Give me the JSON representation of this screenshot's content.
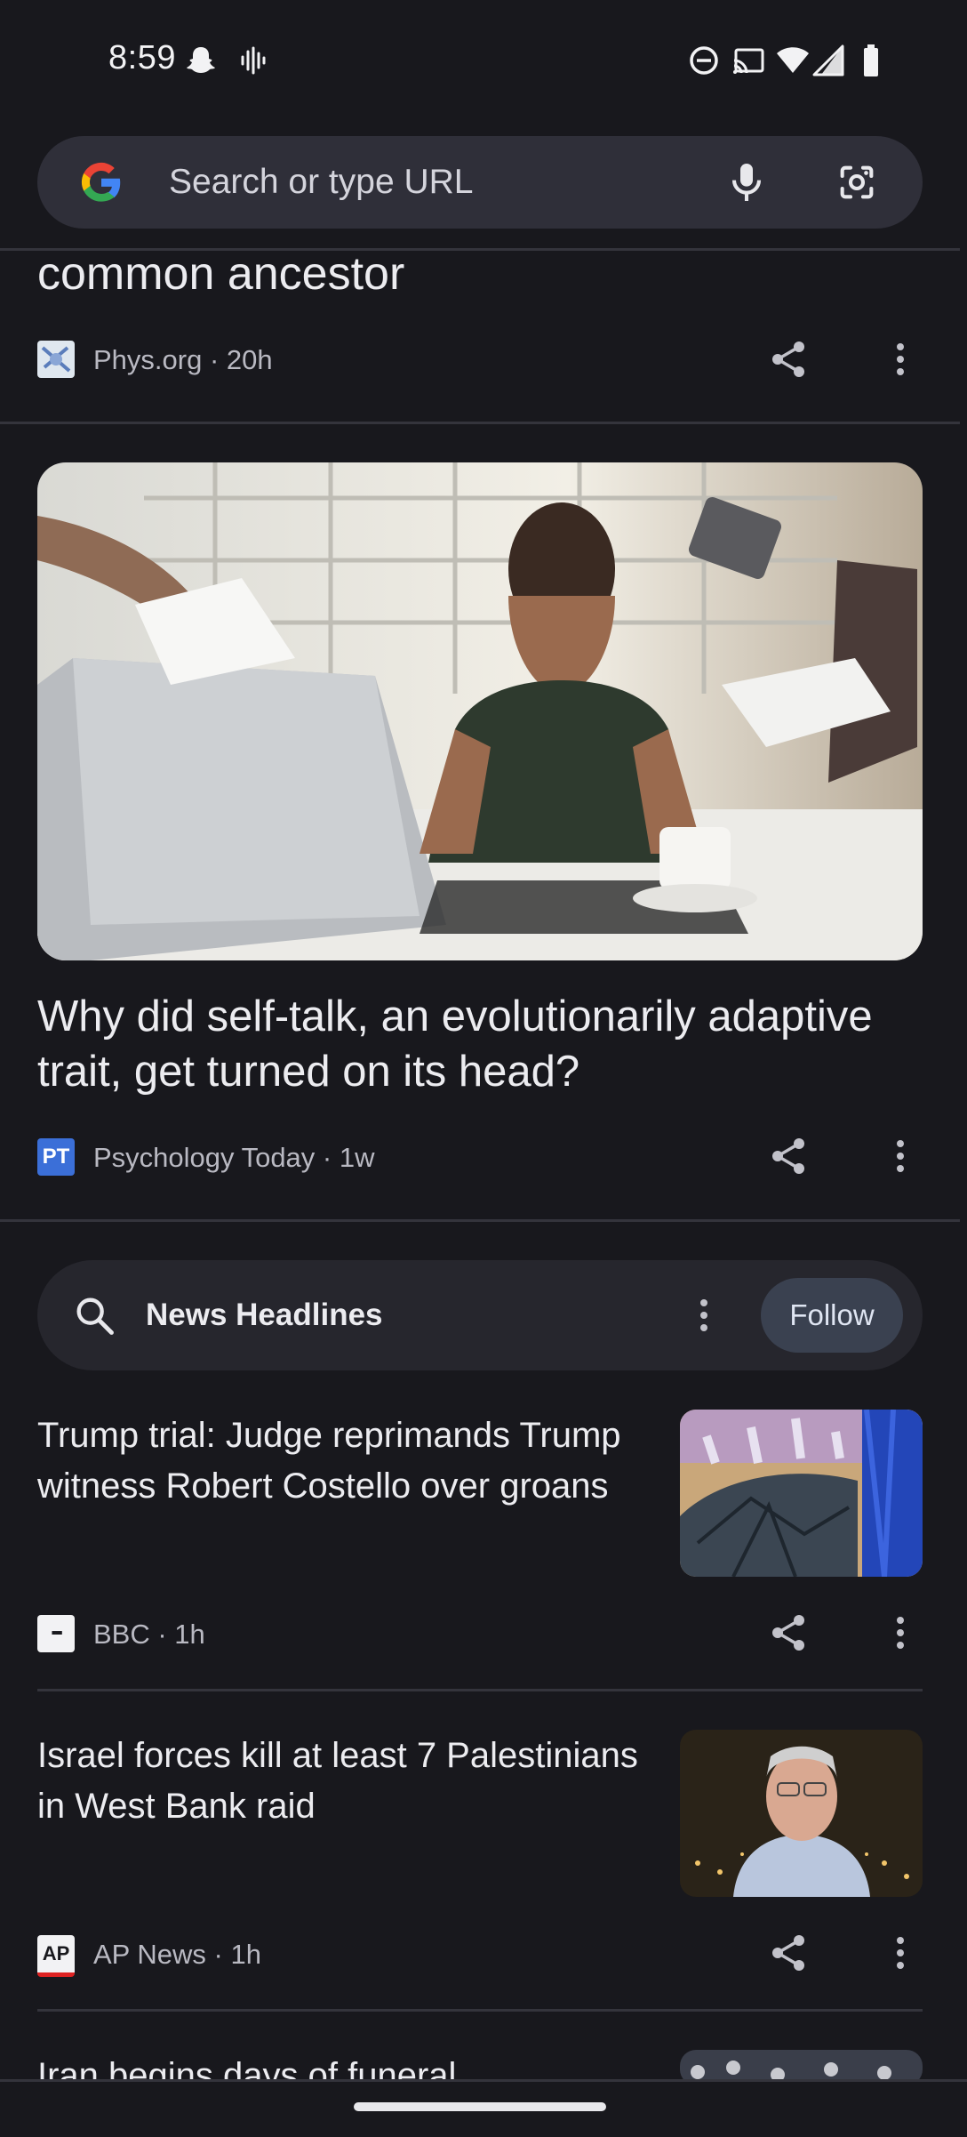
{
  "status_bar": {
    "time": "8:59",
    "icons": [
      "snapchat-icon",
      "audio-wave-icon",
      "do-not-disturb-icon",
      "cast-icon",
      "wifi-icon",
      "signal-icon",
      "battery-icon"
    ]
  },
  "search": {
    "placeholder": "Search or type URL",
    "icons": [
      "google-logo-icon",
      "microphone-icon",
      "lens-camera-icon"
    ]
  },
  "articles": [
    {
      "title": "common ancestor",
      "source": "Phys.org · 20h"
    },
    {
      "title": "Why did self-talk, an evolutionarily adaptive trait, get turned on its head?",
      "source": "Psychology Today · 1w",
      "favicon_text": "PT"
    }
  ],
  "topic": {
    "title": "News Headlines",
    "follow_label": "Follow"
  },
  "news": [
    {
      "title": "Trump trial: Judge reprimands Trump witness Robert Costello over groans",
      "source": "BBC · 1h",
      "favicon_text": "▪▪▪"
    },
    {
      "title": "Israel forces kill at least 7 Palestinians in West Bank raid",
      "source": "AP News · 1h",
      "favicon_text": "AP"
    },
    {
      "title": "Iran begins days of funeral"
    }
  ],
  "colors": {
    "background": "#18181d",
    "search_bar": "#2f2f39",
    "follow_button": "#3a4150",
    "pt_blue": "#3b6fd8"
  }
}
